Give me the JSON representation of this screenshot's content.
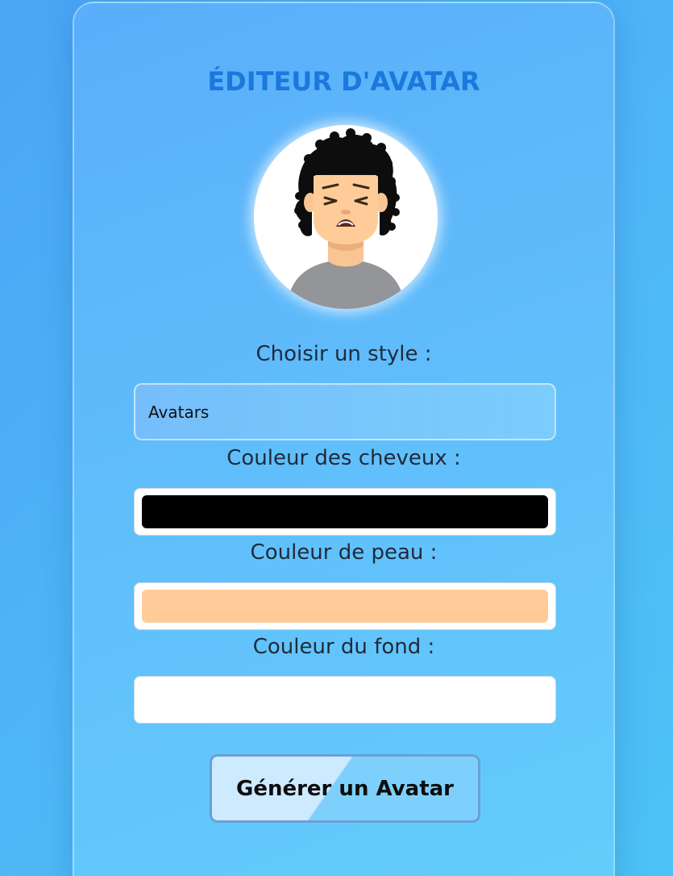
{
  "editor": {
    "title": "ÉDITEUR D'AVATAR",
    "avatar_alt": "avatar-preview"
  },
  "form": {
    "style_label": "Choisir un style :",
    "style_value": "Avatars",
    "hair_label": "Couleur des cheveux :",
    "hair_color": "#000000",
    "skin_label": "Couleur de peau :",
    "skin_color": "#ffcc99",
    "background_label": "Couleur du fond :",
    "background_color": "#ffffff",
    "generate_label": "Générer un Avatar"
  },
  "colors": {
    "accent": "#1b78dc",
    "page_background": "#4fb6f7",
    "shirt": "#939598"
  }
}
